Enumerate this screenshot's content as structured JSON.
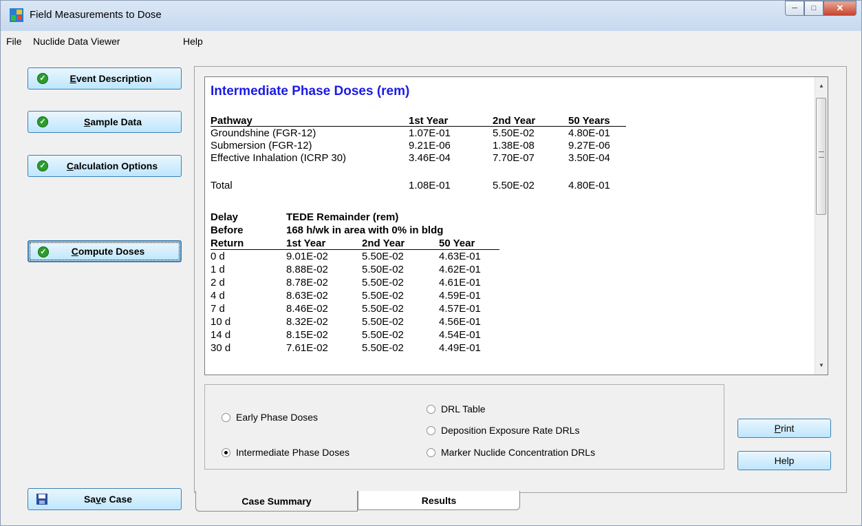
{
  "window": {
    "title": "Field Measurements to Dose"
  },
  "menu": [
    "File",
    "Nuclide Data Viewer",
    "Help"
  ],
  "nav": {
    "event_description": {
      "accel": "E",
      "rest": "vent Description"
    },
    "sample_data": {
      "accel": "S",
      "rest": "ample Data"
    },
    "calculation_options": {
      "accel": "C",
      "rest": "alculation Options"
    },
    "compute_doses": {
      "accel": "C",
      "rest": "ompute Doses"
    },
    "save_case": {
      "pre": "Sa",
      "accel": "v",
      "rest": "e Case"
    }
  },
  "report": {
    "title": "Intermediate Phase Doses (rem)",
    "pathway_headers": [
      "Pathway",
      "1st Year",
      "2nd Year",
      "50 Years"
    ],
    "pathways": [
      [
        "Groundshine (FGR-12)",
        "1.07E-01",
        "5.50E-02",
        "4.80E-01"
      ],
      [
        "Submersion (FGR-12)",
        "9.21E-06",
        "1.38E-08",
        "9.27E-06"
      ],
      [
        "Effective Inhalation (ICRP 30)",
        "3.46E-04",
        "7.70E-07",
        "3.50E-04"
      ]
    ],
    "total": [
      "Total",
      "1.08E-01",
      "5.50E-02",
      "4.80E-01"
    ],
    "delay_header1": [
      "Delay",
      "TEDE Remainder (rem)"
    ],
    "delay_header2": [
      "Before",
      "168 h/wk in area with 0% in bldg"
    ],
    "delay_header3": [
      "Return",
      "1st Year",
      "2nd Year",
      "50 Year"
    ],
    "delay_rows": [
      [
        "0 d",
        "9.01E-02",
        "5.50E-02",
        "4.63E-01"
      ],
      [
        "1 d",
        "8.88E-02",
        "5.50E-02",
        "4.62E-01"
      ],
      [
        "2 d",
        "8.78E-02",
        "5.50E-02",
        "4.61E-01"
      ],
      [
        "4 d",
        "8.63E-02",
        "5.50E-02",
        "4.59E-01"
      ],
      [
        "7 d",
        "8.46E-02",
        "5.50E-02",
        "4.57E-01"
      ],
      [
        "10 d",
        "8.32E-02",
        "5.50E-02",
        "4.56E-01"
      ],
      [
        "14 d",
        "8.15E-02",
        "5.50E-02",
        "4.54E-01"
      ],
      [
        "30 d",
        "7.61E-02",
        "5.50E-02",
        "4.49E-01"
      ]
    ]
  },
  "options": {
    "early": "Early Phase Doses",
    "intermediate": "Intermediate Phase Doses",
    "drl_table": "DRL Table",
    "deposition": "Deposition Exposure Rate DRLs",
    "marker": "Marker Nuclide Concentration DRLs",
    "selected": "intermediate"
  },
  "buttons": {
    "print_accel": "P",
    "print_rest": "rint",
    "help": "Help"
  },
  "tabs": {
    "case_summary": "Case Summary",
    "results": "Results"
  }
}
